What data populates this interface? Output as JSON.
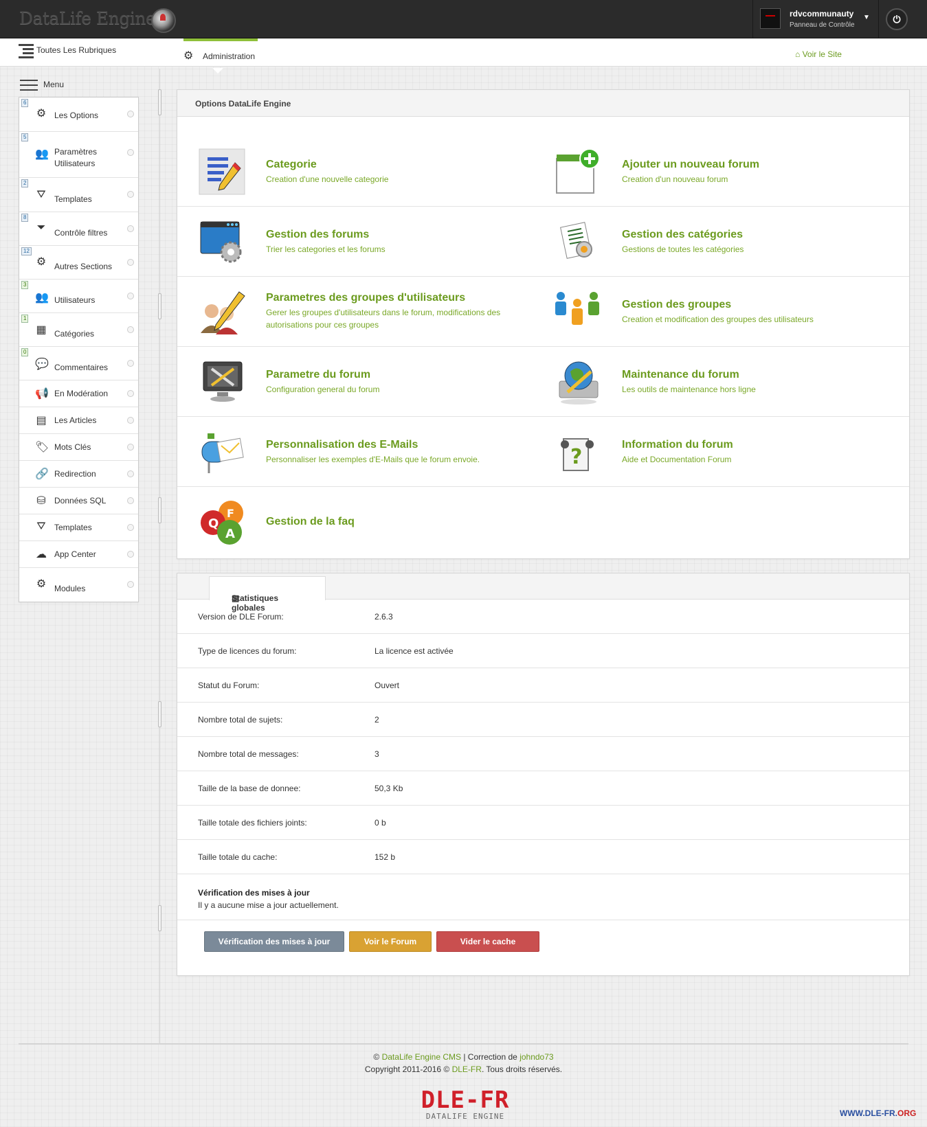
{
  "header": {
    "brand": "DataLife Engine",
    "username": "rdvcommunauty",
    "user_sub": "Panneau de Contrôle"
  },
  "subbar": {
    "all_rubriques": "Toutes Les Rubriques",
    "admin_tab": "Administration",
    "voir_site": "Voir le Site"
  },
  "sidebar": {
    "menu_label": "Menu",
    "items": [
      {
        "label": "Les Options",
        "badge": "6",
        "icon": "gear-icon"
      },
      {
        "label": "Paramètres Utilisateurs",
        "badge": "5",
        "icon": "users-icon"
      },
      {
        "label": "Templates",
        "badge": "2",
        "icon": "templates-icon"
      },
      {
        "label": "Contrôle filtres",
        "badge": "8",
        "icon": "filter-icon"
      },
      {
        "label": "Autres Sections",
        "badge": "12",
        "icon": "gear-icon"
      },
      {
        "label": "Utilisateurs",
        "badge": "3",
        "icon": "users-icon"
      },
      {
        "label": "Catégories",
        "badge": "1",
        "icon": "calendar-icon"
      },
      {
        "label": "Commentaires",
        "badge": "0",
        "icon": "comments-icon"
      },
      {
        "label": "En Modération",
        "badge": "",
        "icon": "megaphone-icon"
      },
      {
        "label": "Les Articles",
        "badge": "",
        "icon": "document-icon"
      },
      {
        "label": "Mots Clés",
        "badge": "",
        "icon": "tags-icon"
      },
      {
        "label": "Redirection",
        "badge": "",
        "icon": "link-icon"
      },
      {
        "label": "Données SQL",
        "badge": "",
        "icon": "database-icon"
      },
      {
        "label": "Templates",
        "badge": "",
        "icon": "templates-icon"
      },
      {
        "label": "App Center",
        "badge": "",
        "icon": "cloud-icon"
      },
      {
        "label": "Modules",
        "badge": "",
        "icon": "gear-icon"
      }
    ]
  },
  "options_panel": {
    "title": "Options DataLife Engine",
    "items": [
      {
        "title": "Categorie",
        "desc": "Creation d'une nouvelle categorie",
        "icon": "category-edit-icon"
      },
      {
        "title": "Ajouter un nouveau forum",
        "desc": "Creation d'un nouveau forum",
        "icon": "add-forum-icon"
      },
      {
        "title": "Gestion des forums",
        "desc": "Trier les categories et les forums",
        "icon": "forum-settings-icon"
      },
      {
        "title": "Gestion des catégories",
        "desc": "Gestions de toutes les catégories",
        "icon": "categories-manage-icon"
      },
      {
        "title": "Parametres des groupes d'utilisateurs",
        "desc": "Gerer les groupes d'utilisateurs dans le forum, modifications des autorisations pour ces groupes",
        "icon": "user-groups-edit-icon"
      },
      {
        "title": "Gestion des groupes",
        "desc": "Creation et modification des groupes des utilisateurs",
        "icon": "groups-icon"
      },
      {
        "title": "Parametre du forum",
        "desc": "Configuration general du forum",
        "icon": "forum-tools-icon"
      },
      {
        "title": "Maintenance du forum",
        "desc": "Les outils de maintenance hors ligne",
        "icon": "maintenance-icon"
      },
      {
        "title": "Personnalisation des E-Mails",
        "desc": "Personnaliser les exemples d'E-Mails que le forum envoie.",
        "icon": "email-icon"
      },
      {
        "title": "Information du forum",
        "desc": "Aide et Documentation Forum",
        "icon": "help-icon"
      },
      {
        "title": "Gestion de la faq",
        "desc": "",
        "icon": "faq-icon"
      }
    ]
  },
  "stats_panel": {
    "tab_label": "Statistiques globales",
    "rows": [
      {
        "key": "Version de DLE Forum:",
        "value": "2.6.3"
      },
      {
        "key": "Type de licences du forum:",
        "value": "La licence est activée"
      },
      {
        "key": "Statut du Forum:",
        "value": "Ouvert"
      },
      {
        "key": "Nombre total de sujets:",
        "value": "2"
      },
      {
        "key": "Nombre total de messages:",
        "value": "3"
      },
      {
        "key": "Taille de la base de donnee:",
        "value": "50,3 Kb"
      },
      {
        "key": "Taille totale des fichiers joints:",
        "value": "0 b"
      },
      {
        "key": "Taille totale du cache:",
        "value": "152 b"
      }
    ],
    "update_title": "Vérification des mises à jour",
    "update_desc": "Il y a aucune mise a jour actuellement.",
    "buttons": {
      "check_updates": "Vérification des mises à jour",
      "view_forum": "Voir le Forum",
      "clear_cache": "Vider le cache"
    }
  },
  "footer": {
    "copy_prefix": "©",
    "dle_cms": "DataLife Engine CMS",
    "correction": "| Correction de",
    "author": "johndo73",
    "copyright_prefix": "Copyright 2011-2016 ©",
    "dlefr": "DLE-FR",
    "rights": ". Tous droits réservés.",
    "logo_big": "DLE-FR",
    "logo_small": "DATALIFE ENGINE",
    "www_prefix": "WWW.DLE-FR.",
    "www_suffix": "ORG"
  },
  "colors": {
    "accent_green": "#6b9b1e",
    "header_bg": "#2b2b2b",
    "btn_gray": "#7b8a99",
    "btn_orange": "#d9a233",
    "btn_red": "#c94f4f"
  }
}
